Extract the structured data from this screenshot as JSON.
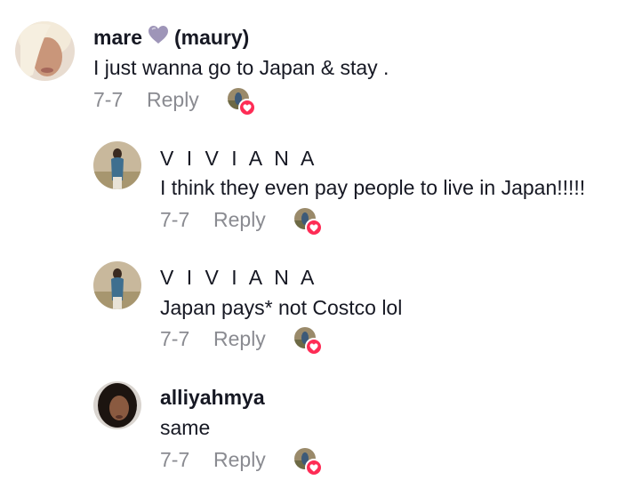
{
  "comments": [
    {
      "username_part1": "mare",
      "username_part2": "(maury)",
      "text": "I just wanna go to Japan & stay .",
      "date": "7-7",
      "reply_label": "Reply"
    },
    {
      "username": "V I V I A N A",
      "text": "I think they even pay people to live in Japan!!!!!",
      "date": "7-7",
      "reply_label": "Reply"
    },
    {
      "username": "V I V I A N A",
      "text": "Japan pays* not Costco lol",
      "date": "7-7",
      "reply_label": "Reply"
    },
    {
      "username": "alliyahmya",
      "text": "same",
      "date": "7-7",
      "reply_label": "Reply"
    }
  ],
  "colors": {
    "text": "#161823",
    "muted": "#8a8b91",
    "like_badge": "#fe2c55",
    "heart_emoji": "#9e95b8"
  },
  "icons": {
    "heart_emoji": "purple-heart-icon",
    "like_badge": "heart-icon"
  }
}
